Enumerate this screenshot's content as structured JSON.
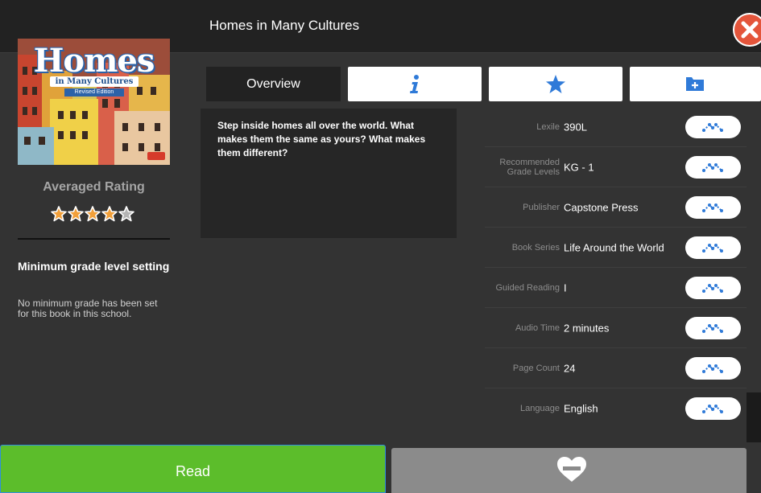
{
  "header": {
    "title": "Homes in Many Cultures",
    "close_icon": "close-icon"
  },
  "cover": {
    "title": "Homes",
    "subtitle": "in Many Cultures",
    "badge": "Revised Edition"
  },
  "rating": {
    "label": "Averaged Rating",
    "stars_filled": 4,
    "stars_total": 5,
    "star_color": "#f2a03a"
  },
  "min_grade": {
    "title": "Minimum grade level setting",
    "text": "No minimum grade has been set for this book in this school."
  },
  "tabs": {
    "overview": "Overview",
    "info_icon": "info-icon",
    "favorite_icon": "star-icon",
    "collection_icon": "add-to-folder-icon"
  },
  "description": "Step inside homes all over the world. What makes them the same as yours? What makes them different?",
  "details": [
    {
      "label": "Lexile",
      "value": "390L"
    },
    {
      "label": "Recommended Grade Levels",
      "value": "KG - 1"
    },
    {
      "label": "Publisher",
      "value": "Capstone Press"
    },
    {
      "label": "Book Series",
      "value": "Life Around the World"
    },
    {
      "label": "Guided Reading",
      "value": "I"
    },
    {
      "label": "Audio Time",
      "value": "2 minutes"
    },
    {
      "label": "Page Count",
      "value": "24"
    },
    {
      "label": "Language",
      "value": "English"
    }
  ],
  "actions": {
    "read_label": "Read",
    "favorite_icon": "heart-minus-icon"
  },
  "colors": {
    "accent_blue": "#2f7ad8",
    "read_green": "#5cbd2b",
    "close_red": "#e4553b"
  }
}
